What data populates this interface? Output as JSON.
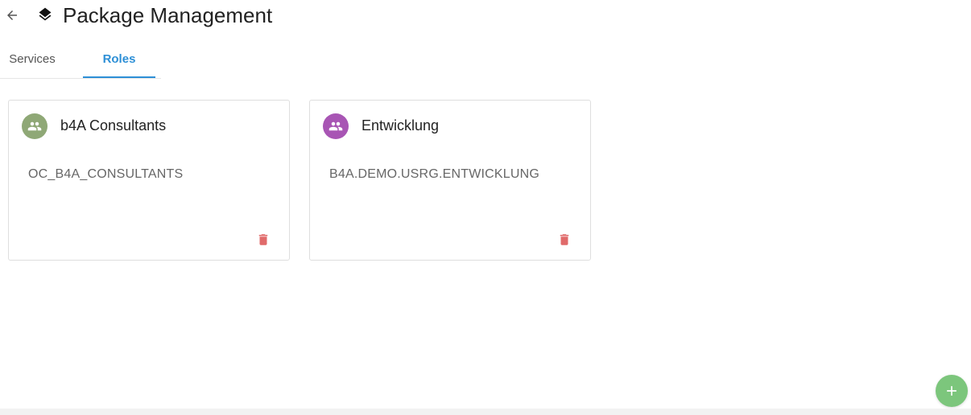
{
  "header": {
    "title": "Package Management",
    "back_icon": "arrow-left-icon",
    "logo_icon": "layers-icon"
  },
  "tabs": [
    {
      "label": "Services",
      "active": false
    },
    {
      "label": "Roles",
      "active": true
    }
  ],
  "roles": [
    {
      "name": "b4A Consultants",
      "code": "OC_B4A_CONSULTANTS",
      "avatar_color": "#8fa876",
      "avatar_icon": "users-icon",
      "action_icon": "trash-icon"
    },
    {
      "name": "Entwicklung",
      "code": "B4A.DEMO.USRG.ENTWICKLUNG",
      "avatar_color": "#a855b4",
      "avatar_icon": "users-icon",
      "action_icon": "trash-icon"
    }
  ],
  "fab": {
    "icon": "plus-icon",
    "color": "#7cc67c"
  },
  "colors": {
    "accent": "#2d8fd6",
    "delete": "#e06a6a"
  }
}
